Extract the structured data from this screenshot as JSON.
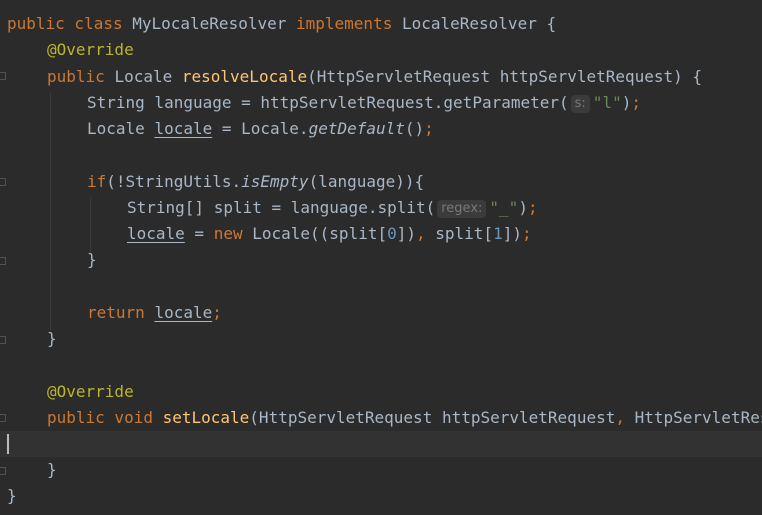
{
  "lines": {
    "l1": {
      "kw1": "public class ",
      "cls": "MyLocaleResolver ",
      "kw2": "implements ",
      "iface": "LocaleResolver {"
    },
    "l2": {
      "ann": "@Override"
    },
    "l3": {
      "kw": "public ",
      "type": "Locale ",
      "fn": "resolveLocale",
      "params": "(HttpServletRequest httpServletRequest) {"
    },
    "l4": {
      "pre": "String language = httpServletRequest.getParameter(",
      "hint": "s:",
      "str": "\"l\"",
      "post": ")",
      "semi": ";"
    },
    "l5": {
      "pre": "Locale ",
      "var": "locale",
      "mid": " = Locale.",
      "call": "getDefault",
      "post": "()",
      "semi": ";"
    },
    "l7": {
      "kw": "if",
      "pre": "(!StringUtils.",
      "call": "isEmpty",
      "post": "(language)){"
    },
    "l8": {
      "pre": "String[] split = language.split(",
      "hint": "regex:",
      "str": "\"_\"",
      "post": ")",
      "semi": ";"
    },
    "l9": {
      "var": "locale",
      "mid": " = ",
      "kw": "new ",
      "pre": "Locale((split[",
      "n0": "0",
      "mid2": "])",
      "comma": ", ",
      "pre2": "split[",
      "n1": "1",
      "post": "])",
      "semi": ";"
    },
    "l10": {
      "text": "}"
    },
    "l12": {
      "kw": "return ",
      "var": "locale",
      "semi": ";"
    },
    "l13": {
      "text": "}"
    },
    "l15": {
      "ann": "@Override"
    },
    "l16": {
      "kw": "public void ",
      "fn": "setLocale",
      "params": "(HttpServletRequest httpServletRequest",
      "comma": ", ",
      "params2": "HttpServletResponse httpServletResponse, Locale locale) {"
    },
    "l18": {
      "text": "}"
    },
    "l19": {
      "text": "}"
    }
  }
}
